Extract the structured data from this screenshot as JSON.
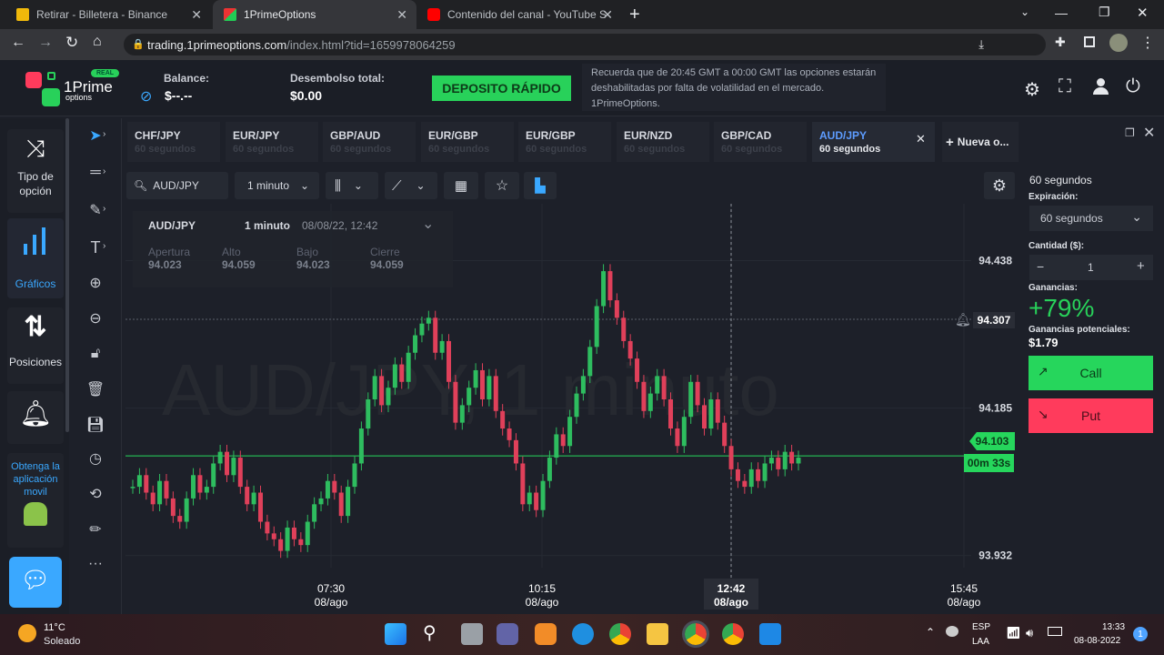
{
  "browser": {
    "tabs": [
      {
        "title": "Retirar - Billetera - Binance"
      },
      {
        "title": "1PrimeOptions"
      },
      {
        "title": "Contenido del canal - YouTube S"
      }
    ],
    "url_domain": "trading.1primeoptions.com",
    "url_path": "/index.html?tid=1659978064259"
  },
  "header": {
    "logo_text": "1Prime",
    "logo_sub": "options",
    "logo_badge": "REAL",
    "balance_label": "Balance:",
    "balance_value": "$--.--",
    "payout_label": "Desembolso total:",
    "payout_value": "$0.00",
    "deposit_button": "DEPOSITO RÁPIDO",
    "notice": "Recuerda que de 20:45 GMT a 00:00 GMT las opciones estarán deshabilitadas por falta de volatilidad en el mercado. 1PrimeOptions."
  },
  "sidebar": {
    "items": [
      {
        "label": "Tipo de opción"
      },
      {
        "label": "Gráficos"
      },
      {
        "label": "Posiciones"
      },
      {
        "label": "Obtenga la aplicación movil"
      }
    ]
  },
  "asset_tabs": [
    {
      "pair": "CHF/JPY",
      "duration": "60 segundos"
    },
    {
      "pair": "EUR/JPY",
      "duration": "60 segundos"
    },
    {
      "pair": "GBP/AUD",
      "duration": "60 segundos"
    },
    {
      "pair": "EUR/GBP",
      "duration": "60 segundos"
    },
    {
      "pair": "EUR/GBP",
      "duration": "60 segundos"
    },
    {
      "pair": "EUR/NZD",
      "duration": "60 segundos"
    },
    {
      "pair": "GBP/CAD",
      "duration": "60 segundos"
    },
    {
      "pair": "AUD/JPY",
      "duration": "60 segundos"
    }
  ],
  "new_tab_label": "Nueva o...",
  "chart_toolbar": {
    "symbol": "AUD/JPY",
    "interval": "1 minuto"
  },
  "ohlc": {
    "pair": "AUD/JPY",
    "interval": "1 minuto",
    "date": "08/08/22, 12:42",
    "open_label": "Apertura",
    "open": "94.023",
    "high_label": "Alto",
    "high": "94.059",
    "low_label": "Bajo",
    "low": "94.023",
    "close_label": "Cierre",
    "close": "94.059"
  },
  "watermark": "AUD/JPY, 1 minuto",
  "price_labels": {
    "alert": "94.307",
    "current": "94.103",
    "countdown": "00m 33s"
  },
  "chart_data": {
    "type": "candlestick",
    "y_ticks": [
      "94.438",
      "94.185",
      "93.932"
    ],
    "x_ticks": [
      {
        "time": "07:30",
        "date": "08/ago"
      },
      {
        "time": "10:15",
        "date": "08/ago"
      },
      {
        "time": "12:42",
        "date": "08/ago"
      },
      {
        "time": "15:45",
        "date": "08/ago"
      }
    ],
    "ylim": [
      93.88,
      94.52
    ],
    "close_series": [
      94.05,
      94.07,
      94.04,
      94.02,
      94.06,
      94.03,
      94.0,
      93.99,
      94.03,
      94.07,
      94.04,
      94.05,
      94.09,
      94.11,
      94.07,
      94.1,
      94.05,
      94.02,
      94.04,
      93.99,
      93.97,
      93.96,
      93.94,
      93.98,
      93.96,
      93.95,
      93.99,
      94.02,
      94.03,
      94.06,
      94.04,
      94.0,
      94.05,
      94.09,
      94.15,
      94.2,
      94.24,
      94.19,
      94.22,
      94.26,
      94.23,
      94.28,
      94.31,
      94.33,
      94.34,
      94.28,
      94.3,
      94.23,
      94.16,
      94.19,
      94.22,
      94.25,
      94.2,
      94.24,
      94.18,
      94.15,
      94.13,
      94.09,
      94.02,
      94.04,
      94.01,
      94.06,
      94.1,
      94.14,
      94.12,
      94.17,
      94.21,
      94.24,
      94.29,
      94.36,
      94.42,
      94.37,
      94.34,
      94.3,
      94.27,
      94.23,
      94.18,
      94.21,
      94.24,
      94.2,
      94.15,
      94.12,
      94.17,
      94.23,
      94.19,
      94.15,
      94.2,
      94.16,
      94.12,
      94.08,
      94.06,
      94.05,
      94.08,
      94.06,
      94.09,
      94.1,
      94.08,
      94.11,
      94.09,
      94.1
    ]
  },
  "right_panel": {
    "duration": "60 segundos",
    "expiration_label": "Expiración:",
    "expiration_value": "60 segundos",
    "amount_label": "Cantidad ($):",
    "amount_minus": "−",
    "amount_value": "1",
    "amount_plus": "+",
    "earnings_label": "Ganancias:",
    "earnings_value": "+79%",
    "potential_label": "Ganancias potenciales:",
    "potential_value": "$1.79",
    "call_label": "Call",
    "put_label": "Put"
  },
  "taskbar": {
    "weather_temp": "11°C",
    "weather_desc": "Soleado",
    "lang_1": "ESP",
    "lang_2": "LAA",
    "time": "13:33",
    "date": "08-08-2022",
    "notif_count": "1"
  },
  "colors": {
    "up": "#2ebd5f",
    "down": "#e0405a",
    "accent_green": "#28d15a",
    "accent_blue": "#5d9cff",
    "put_red": "#ff3b5c"
  }
}
